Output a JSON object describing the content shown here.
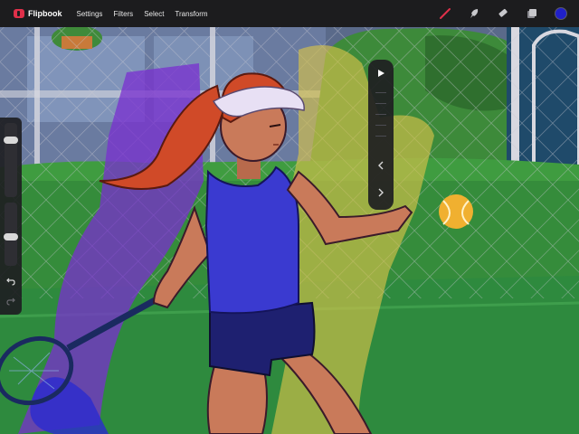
{
  "app": {
    "name": "Flipbook",
    "brand_color": "#e0304a"
  },
  "menu": {
    "items": [
      "Settings",
      "Filters",
      "Select",
      "Transform"
    ]
  },
  "tools": {
    "items": [
      "brush-icon",
      "smudge-icon",
      "eraser-icon",
      "layers-icon"
    ],
    "active_tool": "brush-icon",
    "active_color": "#2020c8"
  },
  "sidebar": {
    "brush_size_level": 0.2,
    "opacity_level": 0.55,
    "undo_icon": "undo-icon",
    "redo_icon": "redo-icon"
  },
  "playback": {
    "play_icon": "play-icon",
    "prev_icon": "chevron-left-icon",
    "next_icon": "chevron-right-icon"
  },
  "canvas": {
    "subject": "tennis player illustration",
    "colors": {
      "court": "#2e8a3e",
      "hedge": "#3f9c40",
      "fence": "#7a7a85",
      "shirt": "#3a3ad0",
      "shorts": "#1e2070",
      "skin": "#c97a5a",
      "hair": "#d04a28",
      "ball": "#f0b030",
      "onion_purple": "#7a2fd0",
      "onion_yellow": "#d6c24a"
    }
  }
}
